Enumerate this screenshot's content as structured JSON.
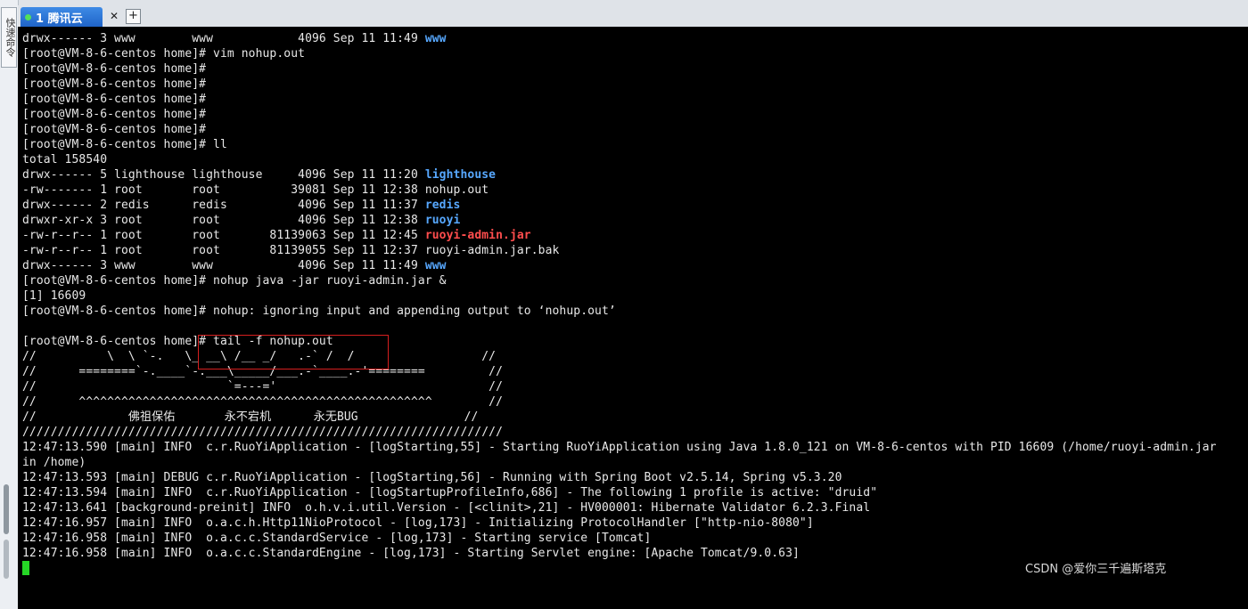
{
  "side": {
    "label": "快速命令"
  },
  "tab": {
    "label": "1 腾讯云",
    "close": "✕",
    "add": "+"
  },
  "colors": {
    "tab_active": "#2a74d8",
    "dir_blue": "#57a8ff",
    "jar_red": "#ff4d4d",
    "cursor_green": "#26d626"
  },
  "terminal": {
    "lines": [
      [
        {
          "t": "drwx------ 3 www        www            4096 Sep 11 11:49 "
        },
        {
          "t": "www",
          "c": "blue-b"
        }
      ],
      [
        {
          "t": "[root@VM-8-6-centos home]# vim nohup.out"
        }
      ],
      [
        {
          "t": "[root@VM-8-6-centos home]#"
        }
      ],
      [
        {
          "t": "[root@VM-8-6-centos home]#"
        }
      ],
      [
        {
          "t": "[root@VM-8-6-centos home]#"
        }
      ],
      [
        {
          "t": "[root@VM-8-6-centos home]#"
        }
      ],
      [
        {
          "t": "[root@VM-8-6-centos home]#"
        }
      ],
      [
        {
          "t": "[root@VM-8-6-centos home]# ll"
        }
      ],
      [
        {
          "t": "total 158540"
        }
      ],
      [
        {
          "t": "drwx------ 5 lighthouse lighthouse     4096 Sep 11 11:20 "
        },
        {
          "t": "lighthouse",
          "c": "blue-b"
        }
      ],
      [
        {
          "t": "-rw------- 1 root       root          39081 Sep 11 12:38 nohup.out"
        }
      ],
      [
        {
          "t": "drwx------ 2 redis      redis          4096 Sep 11 11:37 "
        },
        {
          "t": "redis",
          "c": "blue-b"
        }
      ],
      [
        {
          "t": "drwxr-xr-x 3 root       root           4096 Sep 11 12:38 "
        },
        {
          "t": "ruoyi",
          "c": "blue-b"
        }
      ],
      [
        {
          "t": "-rw-r--r-- 1 root       root       81139063 Sep 11 12:45 "
        },
        {
          "t": "ruoyi-admin.jar",
          "c": "red-b"
        }
      ],
      [
        {
          "t": "-rw-r--r-- 1 root       root       81139055 Sep 11 12:37 ruoyi-admin.jar.bak"
        }
      ],
      [
        {
          "t": "drwx------ 3 www        www            4096 Sep 11 11:49 "
        },
        {
          "t": "www",
          "c": "blue-b"
        }
      ],
      [
        {
          "t": "[root@VM-8-6-centos home]# nohup java -jar ruoyi-admin.jar &"
        }
      ],
      [
        {
          "t": "[1] 16609"
        }
      ],
      [
        {
          "t": "[root@VM-8-6-centos home]# nohup: ignoring input and appending output to ‘nohup.out’"
        }
      ],
      [
        {
          "t": ""
        }
      ],
      [
        {
          "t": "[root@VM-8-6-centos home]# tail -f nohup.out"
        }
      ],
      [
        {
          "t": "//          \\  \\ `-.   \\_ __\\ /__ _/   .-` /  /                  //"
        }
      ],
      [
        {
          "t": "//      ========`-.____`-.___\\_____/___.-`____.-'========         //"
        }
      ],
      [
        {
          "t": "//                           `=---='                              //"
        }
      ],
      [
        {
          "t": "//      ^^^^^^^^^^^^^^^^^^^^^^^^^^^^^^^^^^^^^^^^^^^^^^^^^^        //"
        }
      ],
      [
        {
          "t": "//             佛祖保佑       永不宕机      永无BUG               //"
        }
      ],
      [
        {
          "t": "////////////////////////////////////////////////////////////////////"
        }
      ],
      [
        {
          "t": "12:47:13.590 [main] INFO  c.r.RuoYiApplication - [logStarting,55] - Starting RuoYiApplication using Java 1.8.0_121 on VM-8-6-centos with PID 16609 (/home/ruoyi-admin.jar"
        }
      ],
      [
        {
          "t": "in /home)"
        }
      ],
      [
        {
          "t": "12:47:13.593 [main] DEBUG c.r.RuoYiApplication - [logStarting,56] - Running with Spring Boot v2.5.14, Spring v5.3.20"
        }
      ],
      [
        {
          "t": "12:47:13.594 [main] INFO  c.r.RuoYiApplication - [logStartupProfileInfo,686] - The following 1 profile is active: \"druid\""
        }
      ],
      [
        {
          "t": "12:47:13.641 [background-preinit] INFO  o.h.v.i.util.Version - [<clinit>,21] - HV000001: Hibernate Validator 6.2.3.Final"
        }
      ],
      [
        {
          "t": "12:47:16.957 [main] INFO  o.a.c.h.Http11NioProtocol - [log,173] - Initializing ProtocolHandler [\"http-nio-8080\"]"
        }
      ],
      [
        {
          "t": "12:47:16.958 [main] INFO  o.a.c.c.StandardService - [log,173] - Starting service [Tomcat]"
        }
      ],
      [
        {
          "t": "12:47:16.958 [main] INFO  o.a.c.c.StandardEngine - [log,173] - Starting Servlet engine: [Apache Tomcat/9.0.63]"
        }
      ]
    ]
  },
  "watermark": "CSDN @爱你三千遍斯塔克"
}
